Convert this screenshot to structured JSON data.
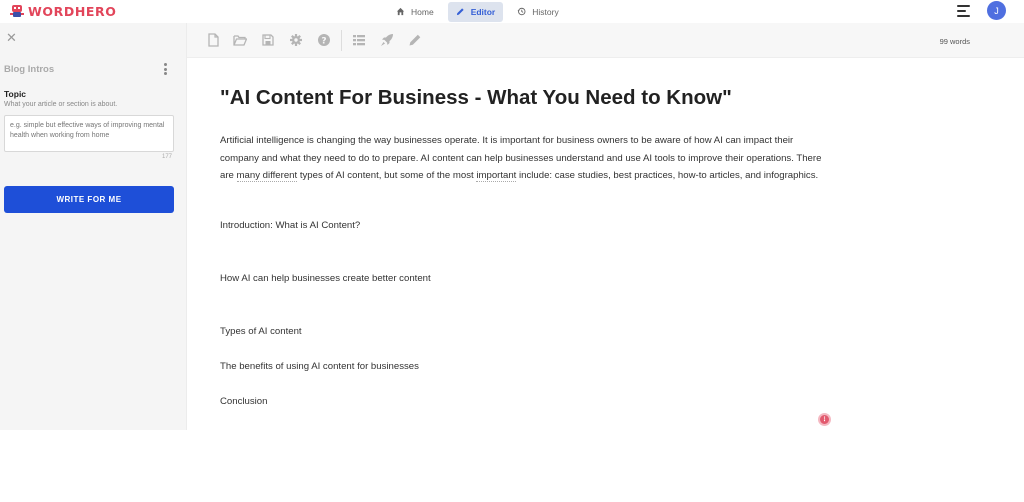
{
  "app": {
    "logo_text_a": "WORD",
    "logo_text_b": "HERO",
    "brand_color": "#e2455a",
    "accent_color": "#1e4fd8"
  },
  "nav": {
    "home": "Home",
    "editor": "Editor",
    "history": "History"
  },
  "user": {
    "avatar_initial": "J"
  },
  "sidebar": {
    "panel_title": "Blog Intros",
    "topic_label": "Topic",
    "topic_help": "What your article or section is about.",
    "topic_placeholder": "e.g. simple but effective ways of improving mental health when working from home",
    "char_count": "177",
    "write_button": "WRITE FOR ME"
  },
  "toolbar": {
    "icons": [
      "new-file-icon",
      "open-folder-icon",
      "save-icon",
      "settings-gear-icon",
      "help-circle-icon",
      "list-icon",
      "rocket-icon",
      "pencil-icon"
    ],
    "word_count": "99 words"
  },
  "document": {
    "title": "\"AI Content For Business - What You Need to Know\"",
    "para_part1": " Artificial intelligence is changing the way businesses operate. It is important for business owners to be aware of how AI can impact their company and what they need to do to prepare. AI content can help businesses understand and use AI tools to improve their operations. There are ",
    "para_ul1": "many different",
    "para_part2": " types of AI content, but some of the most ",
    "para_ul2": "important",
    "para_part3": " include: case studies, best practices, how-to articles, and infographics.",
    "lines": [
      "Introduction: What is AI Content?",
      "How AI can help businesses create better content",
      "Types of AI content",
      "The benefits of using AI content for businesses",
      "Conclusion"
    ]
  }
}
